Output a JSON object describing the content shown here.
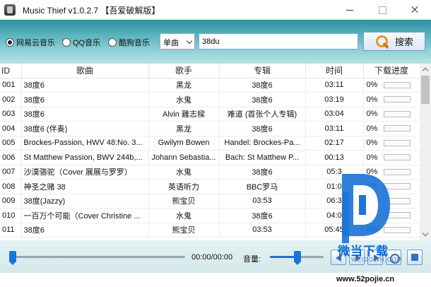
{
  "window": {
    "title": "Music Thief  v1.0.2.7 【吾爱破解版】",
    "minimize": "minimize",
    "maximize": "maximize",
    "close": "close"
  },
  "search": {
    "sources": [
      {
        "label": "网易云音乐",
        "selected": true
      },
      {
        "label": "QQ音乐",
        "selected": false
      },
      {
        "label": "酷狗音乐",
        "selected": false
      }
    ],
    "mode": "单曲",
    "query": "38du",
    "button_label": "搜索"
  },
  "table": {
    "columns": [
      "ID",
      "歌曲",
      "歌手",
      "专辑",
      "时间",
      "下载进度"
    ],
    "rows": [
      {
        "id": "001",
        "song": "38度6",
        "artist": "黑龙",
        "album": "38度6",
        "time": "03:11",
        "progress": "0%",
        "progress_value": 0
      },
      {
        "id": "002",
        "song": "38度6",
        "artist": "水鬼",
        "album": "38度6",
        "time": "03:19",
        "progress": "0%",
        "progress_value": 0
      },
      {
        "id": "003",
        "song": "38度6",
        "artist": "Alvin 雞志樑",
        "album": "难道 (首张个人专辑)",
        "time": "03:04",
        "progress": "0%",
        "progress_value": 0
      },
      {
        "id": "004",
        "song": "38度6 (伴奏)",
        "artist": "黑龙",
        "album": "38度6",
        "time": "03:11",
        "progress": "0%",
        "progress_value": 0
      },
      {
        "id": "005",
        "song": "Brockes-Passion, HWV 48:No. 3...",
        "artist": "Gwilym Bowen",
        "album": "Handel: Brockes-Pa...",
        "time": "02:17",
        "progress": "0%",
        "progress_value": 0
      },
      {
        "id": "006",
        "song": "St Matthew Passion, BWV 244b,...",
        "artist": "Johann Sebastia...",
        "album": "Bach: St Matthew P...",
        "time": "00:13",
        "progress": "0%",
        "progress_value": 0
      },
      {
        "id": "007",
        "song": "沙漠骆驼（Cover 展展与罗罗）",
        "artist": "水鬼",
        "album": "38度6",
        "time": "05:3",
        "progress": "0%",
        "progress_value": 0
      },
      {
        "id": "008",
        "song": "神圣之赌 38",
        "artist": "英语听力",
        "album": "BBC罗马",
        "time": "01:0",
        "progress": "0%",
        "progress_value": 0
      },
      {
        "id": "009",
        "song": "38度(Jazzy)",
        "artist": "熊宝贝",
        "album": "03:53",
        "time": "06:3",
        "progress": "0%",
        "progress_value": 0
      },
      {
        "id": "010",
        "song": "一百万个可能（Cover Christine ...",
        "artist": "水鬼",
        "album": "38度6",
        "time": "04:0",
        "progress": "0%",
        "progress_value": 0
      },
      {
        "id": "011",
        "song": "38度6",
        "artist": "熊宝贝",
        "album": "03:53",
        "time": "05:45",
        "progress": "0%",
        "progress_value": 0
      }
    ]
  },
  "player": {
    "time": "00:00/00:00",
    "volume_label": "音量:",
    "seek_position": 0,
    "volume_level": 0.45
  },
  "watermark": {
    "name": "微当下载",
    "domain": "WEIDOWN.COM",
    "site": "www.52pojie.cn"
  },
  "colors": {
    "accent": "#1874d6",
    "header_gradient_top": "#2f8f9f",
    "header_gradient_bottom": "#b7e2e5",
    "search_icon": "#f1921d"
  }
}
